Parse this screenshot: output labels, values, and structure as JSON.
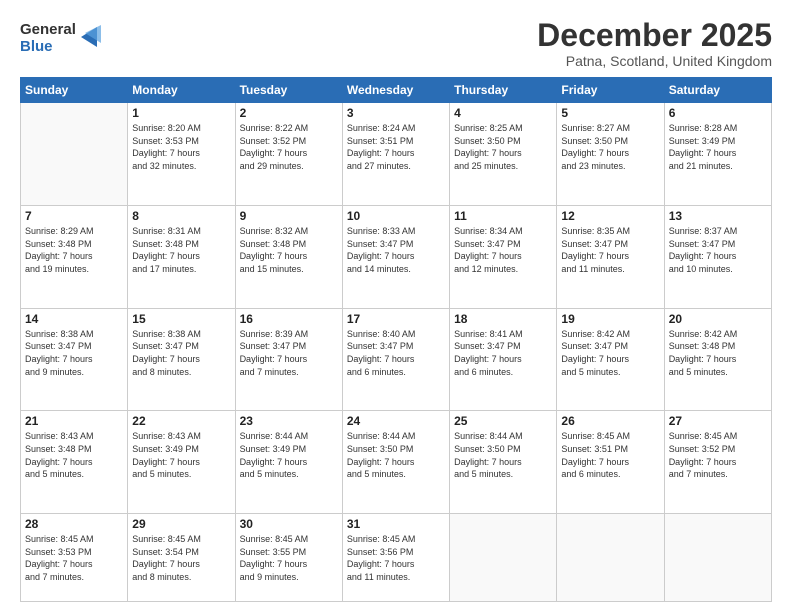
{
  "logo": {
    "general": "General",
    "blue": "Blue"
  },
  "header": {
    "month": "December 2025",
    "location": "Patna, Scotland, United Kingdom"
  },
  "weekdays": [
    "Sunday",
    "Monday",
    "Tuesday",
    "Wednesday",
    "Thursday",
    "Friday",
    "Saturday"
  ],
  "weeks": [
    [
      {
        "day": "",
        "info": ""
      },
      {
        "day": "1",
        "info": "Sunrise: 8:20 AM\nSunset: 3:53 PM\nDaylight: 7 hours\nand 32 minutes."
      },
      {
        "day": "2",
        "info": "Sunrise: 8:22 AM\nSunset: 3:52 PM\nDaylight: 7 hours\nand 29 minutes."
      },
      {
        "day": "3",
        "info": "Sunrise: 8:24 AM\nSunset: 3:51 PM\nDaylight: 7 hours\nand 27 minutes."
      },
      {
        "day": "4",
        "info": "Sunrise: 8:25 AM\nSunset: 3:50 PM\nDaylight: 7 hours\nand 25 minutes."
      },
      {
        "day": "5",
        "info": "Sunrise: 8:27 AM\nSunset: 3:50 PM\nDaylight: 7 hours\nand 23 minutes."
      },
      {
        "day": "6",
        "info": "Sunrise: 8:28 AM\nSunset: 3:49 PM\nDaylight: 7 hours\nand 21 minutes."
      }
    ],
    [
      {
        "day": "7",
        "info": "Sunrise: 8:29 AM\nSunset: 3:48 PM\nDaylight: 7 hours\nand 19 minutes."
      },
      {
        "day": "8",
        "info": "Sunrise: 8:31 AM\nSunset: 3:48 PM\nDaylight: 7 hours\nand 17 minutes."
      },
      {
        "day": "9",
        "info": "Sunrise: 8:32 AM\nSunset: 3:48 PM\nDaylight: 7 hours\nand 15 minutes."
      },
      {
        "day": "10",
        "info": "Sunrise: 8:33 AM\nSunset: 3:47 PM\nDaylight: 7 hours\nand 14 minutes."
      },
      {
        "day": "11",
        "info": "Sunrise: 8:34 AM\nSunset: 3:47 PM\nDaylight: 7 hours\nand 12 minutes."
      },
      {
        "day": "12",
        "info": "Sunrise: 8:35 AM\nSunset: 3:47 PM\nDaylight: 7 hours\nand 11 minutes."
      },
      {
        "day": "13",
        "info": "Sunrise: 8:37 AM\nSunset: 3:47 PM\nDaylight: 7 hours\nand 10 minutes."
      }
    ],
    [
      {
        "day": "14",
        "info": "Sunrise: 8:38 AM\nSunset: 3:47 PM\nDaylight: 7 hours\nand 9 minutes."
      },
      {
        "day": "15",
        "info": "Sunrise: 8:38 AM\nSunset: 3:47 PM\nDaylight: 7 hours\nand 8 minutes."
      },
      {
        "day": "16",
        "info": "Sunrise: 8:39 AM\nSunset: 3:47 PM\nDaylight: 7 hours\nand 7 minutes."
      },
      {
        "day": "17",
        "info": "Sunrise: 8:40 AM\nSunset: 3:47 PM\nDaylight: 7 hours\nand 6 minutes."
      },
      {
        "day": "18",
        "info": "Sunrise: 8:41 AM\nSunset: 3:47 PM\nDaylight: 7 hours\nand 6 minutes."
      },
      {
        "day": "19",
        "info": "Sunrise: 8:42 AM\nSunset: 3:47 PM\nDaylight: 7 hours\nand 5 minutes."
      },
      {
        "day": "20",
        "info": "Sunrise: 8:42 AM\nSunset: 3:48 PM\nDaylight: 7 hours\nand 5 minutes."
      }
    ],
    [
      {
        "day": "21",
        "info": "Sunrise: 8:43 AM\nSunset: 3:48 PM\nDaylight: 7 hours\nand 5 minutes."
      },
      {
        "day": "22",
        "info": "Sunrise: 8:43 AM\nSunset: 3:49 PM\nDaylight: 7 hours\nand 5 minutes."
      },
      {
        "day": "23",
        "info": "Sunrise: 8:44 AM\nSunset: 3:49 PM\nDaylight: 7 hours\nand 5 minutes."
      },
      {
        "day": "24",
        "info": "Sunrise: 8:44 AM\nSunset: 3:50 PM\nDaylight: 7 hours\nand 5 minutes."
      },
      {
        "day": "25",
        "info": "Sunrise: 8:44 AM\nSunset: 3:50 PM\nDaylight: 7 hours\nand 5 minutes."
      },
      {
        "day": "26",
        "info": "Sunrise: 8:45 AM\nSunset: 3:51 PM\nDaylight: 7 hours\nand 6 minutes."
      },
      {
        "day": "27",
        "info": "Sunrise: 8:45 AM\nSunset: 3:52 PM\nDaylight: 7 hours\nand 7 minutes."
      }
    ],
    [
      {
        "day": "28",
        "info": "Sunrise: 8:45 AM\nSunset: 3:53 PM\nDaylight: 7 hours\nand 7 minutes."
      },
      {
        "day": "29",
        "info": "Sunrise: 8:45 AM\nSunset: 3:54 PM\nDaylight: 7 hours\nand 8 minutes."
      },
      {
        "day": "30",
        "info": "Sunrise: 8:45 AM\nSunset: 3:55 PM\nDaylight: 7 hours\nand 9 minutes."
      },
      {
        "day": "31",
        "info": "Sunrise: 8:45 AM\nSunset: 3:56 PM\nDaylight: 7 hours\nand 11 minutes."
      },
      {
        "day": "",
        "info": ""
      },
      {
        "day": "",
        "info": ""
      },
      {
        "day": "",
        "info": ""
      }
    ]
  ]
}
